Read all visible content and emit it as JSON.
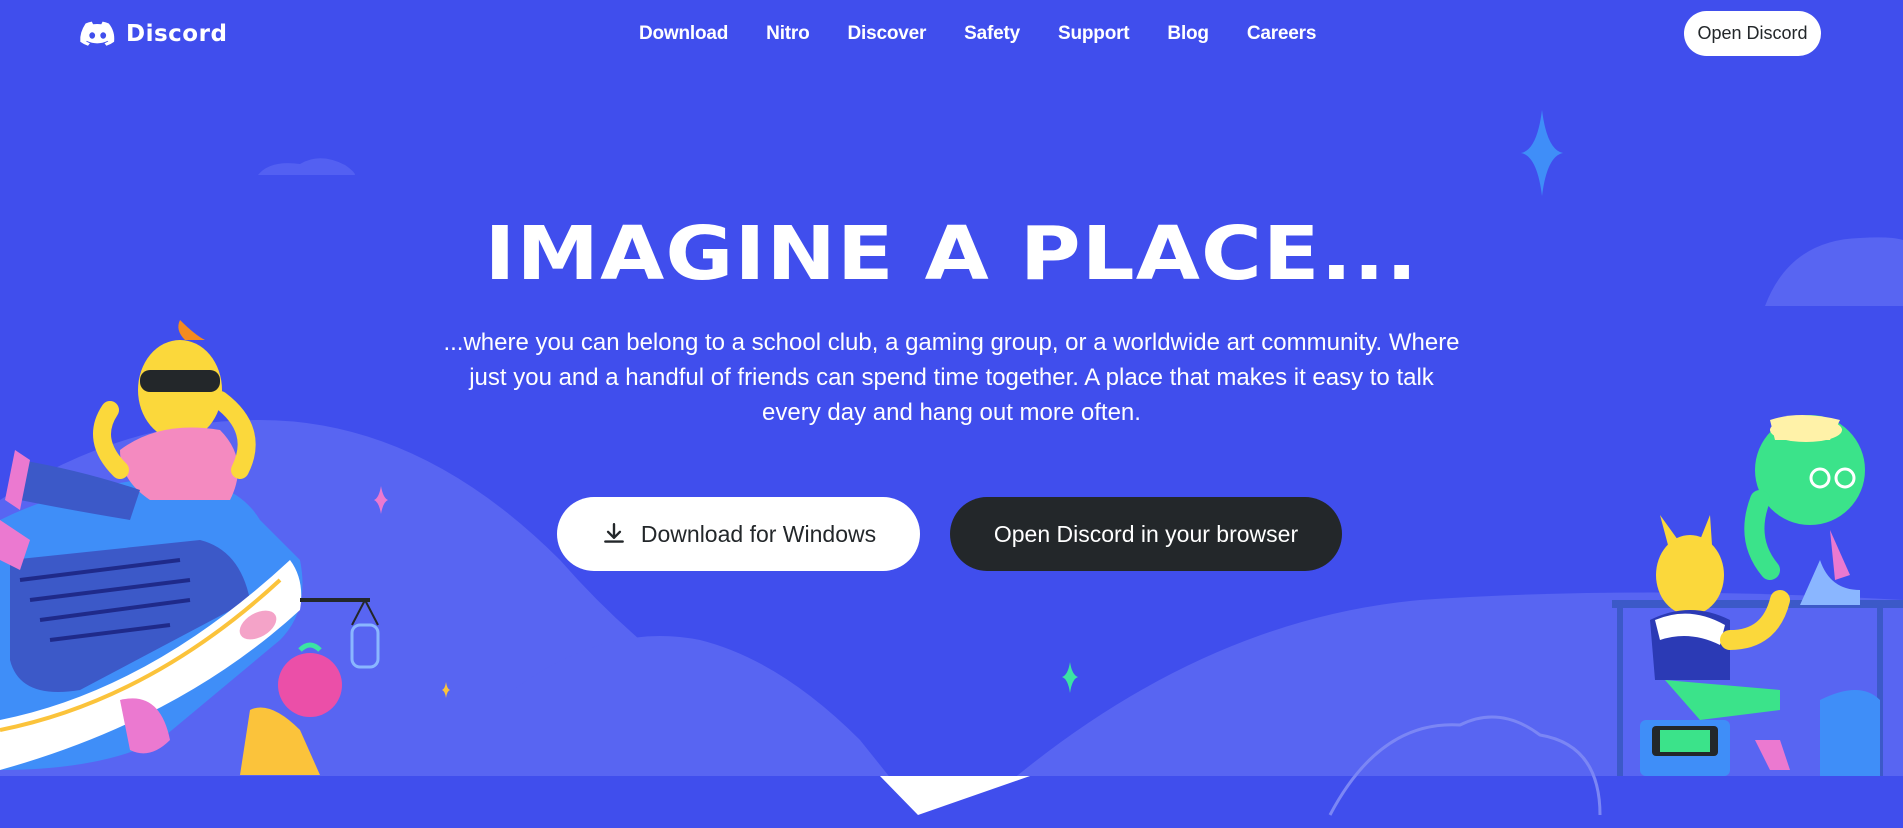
{
  "brand": {
    "name": "Discord"
  },
  "nav": {
    "links": [
      "Download",
      "Nitro",
      "Discover",
      "Safety",
      "Support",
      "Blog",
      "Careers"
    ],
    "open_button": "Open Discord"
  },
  "hero": {
    "title": "IMAGINE A PLACE...",
    "description": "...where you can belong to a school club, a gaming group, or a worldwide art community. Where just you and a handful of friends can spend time together. A place that makes it easy to talk every day and hang out more often.",
    "download_button": "Download for Windows",
    "browser_button": "Open Discord in your browser"
  },
  "colors": {
    "background": "#404eed",
    "hills": "#5865f2",
    "dark_button": "#23272a",
    "white": "#ffffff"
  },
  "icons": [
    "discord-logo-icon",
    "download-icon"
  ]
}
